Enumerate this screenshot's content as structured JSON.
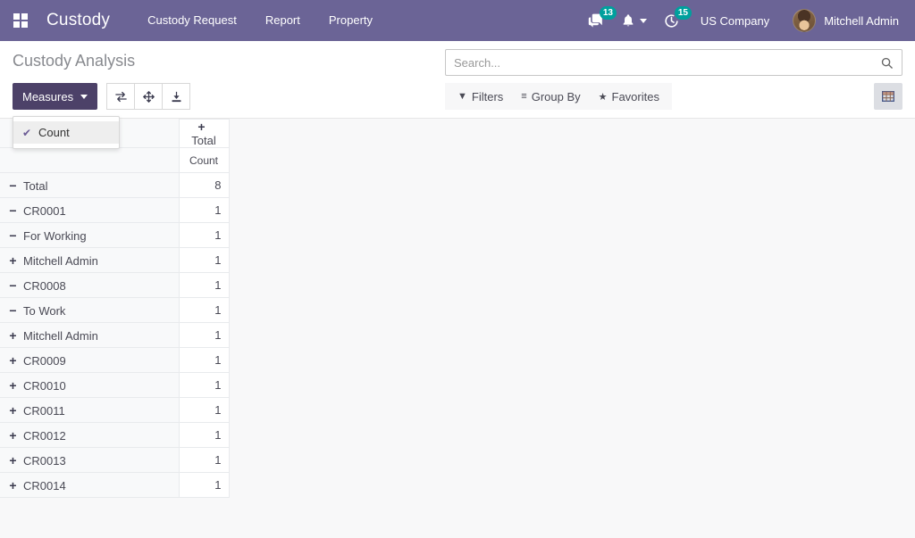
{
  "navbar": {
    "apps_icon": "apps-grid-icon",
    "brand": "Custody",
    "menu_items": [
      {
        "label": "Custody Request"
      },
      {
        "label": "Report"
      },
      {
        "label": "Property"
      }
    ],
    "messages_icon": "messages-icon",
    "messages_count": "13",
    "activity_icon": "bell-icon",
    "clock_icon": "clock-activity-icon",
    "clock_count": "15",
    "company": "US Company",
    "user_name": "Mitchell Admin",
    "avatar": "user-avatar"
  },
  "control_panel": {
    "page_title": "Custody Analysis",
    "measures_label": "Measures",
    "buttons": [
      {
        "name": "flip-axis-button",
        "icon": "flip-axis-icon"
      },
      {
        "name": "expand-all-button",
        "icon": "expand-all-icon"
      },
      {
        "name": "download-xlsx-button",
        "icon": "download-icon"
      }
    ],
    "search": {
      "placeholder": "Search...",
      "value": "",
      "icon": "search-icon"
    },
    "filter_menu": [
      {
        "name": "filters-menu",
        "glyph": "▼",
        "label": "Filters"
      },
      {
        "name": "group-by-menu",
        "glyph": "≡",
        "label": "Group By"
      },
      {
        "name": "favorites-menu",
        "glyph": "★",
        "label": "Favorites"
      }
    ],
    "view_switcher": [
      {
        "name": "pivot-view-button",
        "icon": "pivot-grid-icon",
        "active": true
      }
    ]
  },
  "measures_dropdown": {
    "open": true,
    "items": [
      {
        "label": "Count",
        "checked": true,
        "check_glyph": "✔"
      }
    ]
  },
  "pivot": {
    "header": {
      "total_label": "Total",
      "total_toggle": "+",
      "measure_label": "Count"
    },
    "rows": [
      {
        "label": "Total",
        "toggle": "−",
        "level": 0,
        "value": "8"
      },
      {
        "label": "CR0001",
        "toggle": "−",
        "level": 1,
        "value": "1"
      },
      {
        "label": "For Working",
        "toggle": "−",
        "level": 2,
        "value": "1"
      },
      {
        "label": "Mitchell Admin",
        "toggle": "+",
        "level": 3,
        "value": "1"
      },
      {
        "label": "CR0008",
        "toggle": "−",
        "level": 1,
        "value": "1"
      },
      {
        "label": "To Work",
        "toggle": "−",
        "level": 2,
        "value": "1"
      },
      {
        "label": "Mitchell Admin",
        "toggle": "+",
        "level": 3,
        "value": "1"
      },
      {
        "label": "CR0009",
        "toggle": "+",
        "level": 1,
        "value": "1"
      },
      {
        "label": "CR0010",
        "toggle": "+",
        "level": 1,
        "value": "1"
      },
      {
        "label": "CR0011",
        "toggle": "+",
        "level": 1,
        "value": "1"
      },
      {
        "label": "CR0012",
        "toggle": "+",
        "level": 1,
        "value": "1"
      },
      {
        "label": "CR0013",
        "toggle": "+",
        "level": 1,
        "value": "1"
      },
      {
        "label": "CR0014",
        "toggle": "+",
        "level": 1,
        "value": "1"
      }
    ]
  },
  "colors": {
    "brand_purple": "#6b6496",
    "measures_purple": "#4c4168",
    "badge_teal": "#00a09d",
    "page_bg": "#f8f8f9",
    "row_label_bg": "#f8f9fa",
    "border": "#e8eaed"
  }
}
